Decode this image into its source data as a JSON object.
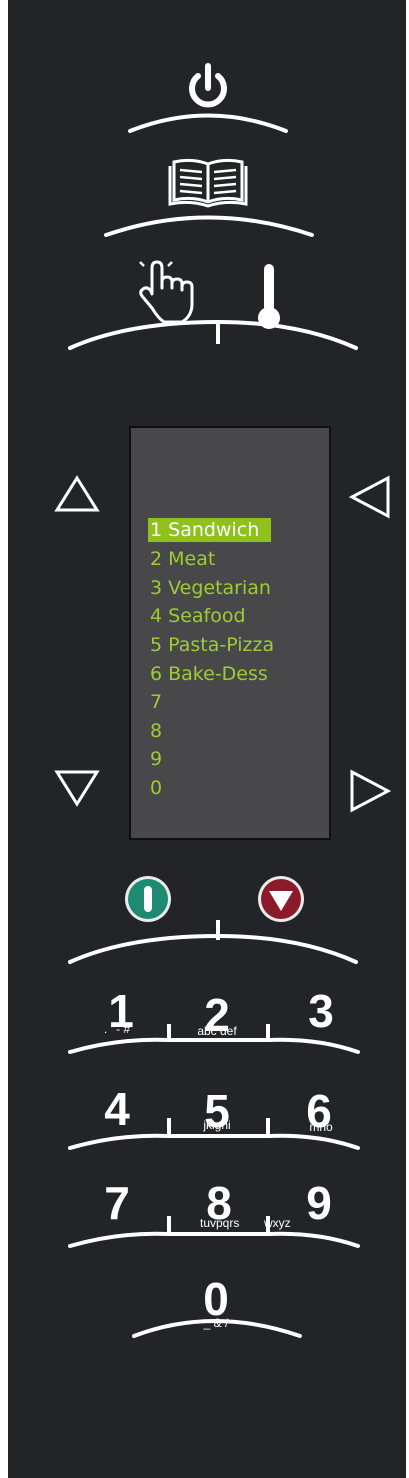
{
  "panel": {
    "top_buttons": [
      {
        "name": "power",
        "icon": "power-icon"
      },
      {
        "name": "recipe-book",
        "icon": "book-icon"
      },
      {
        "name": "manual",
        "icon": "hand-pointer-icon"
      },
      {
        "name": "temperature",
        "icon": "thermometer-icon"
      }
    ],
    "display": {
      "menu": [
        {
          "label": "1 Sandwich",
          "selected": true
        },
        {
          "label": "2 Meat"
        },
        {
          "label": "3 Vegetarian"
        },
        {
          "label": "4 Seafood"
        },
        {
          "label": "5 Pasta-Pizza"
        },
        {
          "label": "6 Bake-Dess"
        },
        {
          "label": "7"
        },
        {
          "label": "8"
        },
        {
          "label": "9"
        },
        {
          "label": "0"
        }
      ],
      "colors": {
        "text": "#9ccd32",
        "highlight": "#8ec21a",
        "background": "#48484a"
      }
    },
    "nav": {
      "up": "triangle-up-icon",
      "down": "triangle-down-icon",
      "left": "triangle-left-icon",
      "right": "triangle-right-icon"
    },
    "start_stop": {
      "start_color": "#1f8a72",
      "stop_color": "#8b1a2a"
    },
    "keypad": {
      "keys": [
        {
          "digit": "1",
          "letters": ". ' - #"
        },
        {
          "digit": "2",
          "letters": "abc def"
        },
        {
          "digit": "3",
          "letters": ""
        },
        {
          "digit": "4",
          "letters": ""
        },
        {
          "digit": "5",
          "letters": "jklghi"
        },
        {
          "digit": "6",
          "letters": "mno"
        },
        {
          "digit": "7",
          "letters": ""
        },
        {
          "digit": "8",
          "letters": "tuvpqrs"
        },
        {
          "digit": "9",
          "letters": "wxyz"
        },
        {
          "digit": "0",
          "letters": "_ & /"
        }
      ]
    }
  }
}
